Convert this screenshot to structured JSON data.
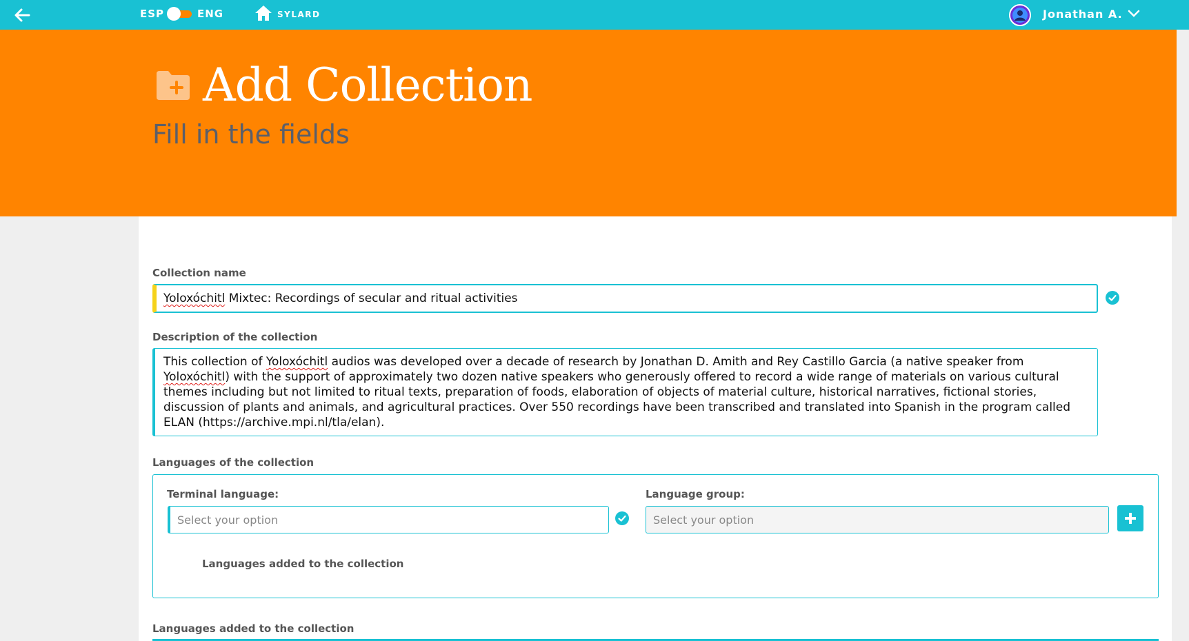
{
  "topbar": {
    "lang_left": "ESP",
    "lang_right": "ENG",
    "home_label": "SYLARD",
    "user_name": "Jonathan A.",
    "icons": [
      "back-arrow-icon",
      "home-icon",
      "user-avatar-icon",
      "chevron-down-icon"
    ],
    "colors": {
      "bar": "#19c1d3",
      "toggle": "#ff8400"
    }
  },
  "hero": {
    "title": "Add Collection",
    "subtitle": "Fill in the fields",
    "icon": "folder-plus-icon",
    "background": "#ff8400"
  },
  "form": {
    "collection_name": {
      "label": "Collection name",
      "value_misspelled_word": "Yoloxóchitl",
      "value_rest": " Mixtec: Recordings of secular and ritual activities",
      "valid": true
    },
    "description": {
      "label": "Description of the collection",
      "part1": "This collection of ",
      "word1": "Yoloxóchitl",
      "part2": " audios was developed over a decade of research by Jonathan D. Amith and Rey Castillo Garcia (a native speaker from ",
      "word2": "Yoloxóchitl",
      "part3": ") with the support of approximately two dozen native speakers who generously offered to record a wide range of materials on various cultural themes including but not limited to ritual texts, preparation of foods, elaboration of objects of material culture, historical narratives, fictional stories, discussion of plants and animals, and agricultural practices. Over 550 recordings have been transcribed and translated into Spanish in the program called ELAN (https://archive.mpi.nl/tla/elan)."
    },
    "languages": {
      "label": "Languages of the collection",
      "terminal_label": "Terminal language:",
      "terminal_placeholder": "Select your option",
      "group_label": "Language group:",
      "group_placeholder": "Select your option",
      "added_label": "Languages added to the collection"
    },
    "languages_added_section_label": "Languages added to the collection"
  }
}
